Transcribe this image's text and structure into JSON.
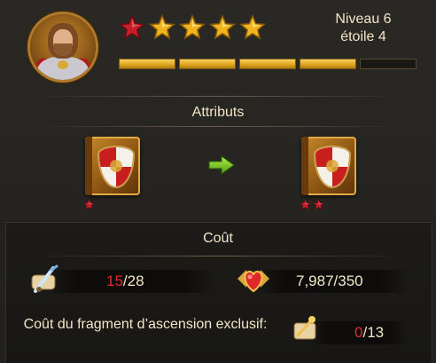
{
  "hero": {
    "portrait_icon": "hero-portrait-icon",
    "stars_total": 5,
    "stars_red": 1,
    "level_label": "Niveau 6",
    "star_label": "étoile 4",
    "progress_segments_total": 5,
    "progress_segments_filled": 4
  },
  "attributes": {
    "title": "Attributs",
    "from_stars": 1,
    "to_stars": 2,
    "item_icon": "heraldic-book-icon",
    "arrow_icon": "green-arrow-right-icon"
  },
  "cost": {
    "title": "Coût",
    "resource1": {
      "icon": "scroll-quill-icon",
      "have": "15",
      "sep": "/",
      "need": "28"
    },
    "resource2": {
      "icon": "heart-medal-icon",
      "value": "7,987/350"
    },
    "fragment_label": "Coût du fragment d’ascension exclusif:",
    "fragment": {
      "icon": "ascension-fragment-icon",
      "have": "0",
      "sep": "/",
      "need": "13"
    }
  },
  "colors": {
    "gold": "#e2a820",
    "red": "#e42a2a",
    "text": "#f1e6c8",
    "background": "#23211d"
  }
}
